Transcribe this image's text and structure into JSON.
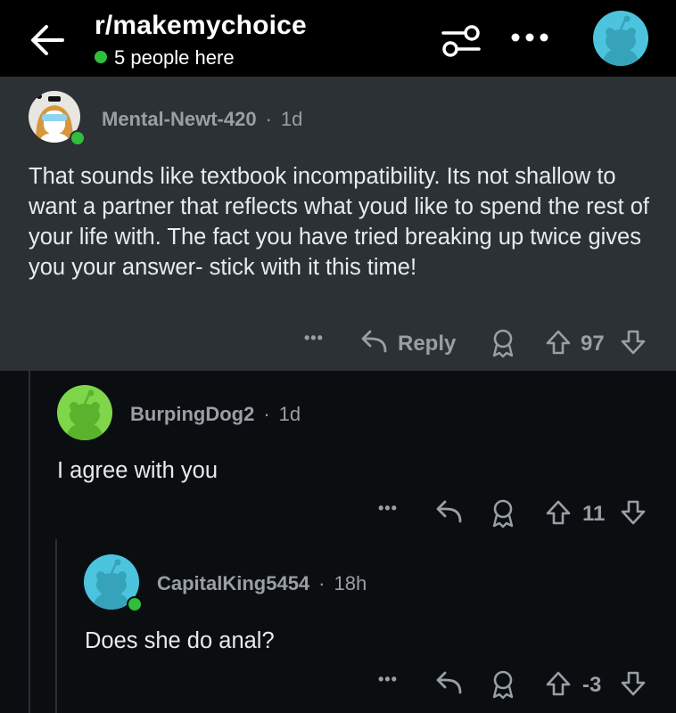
{
  "header": {
    "subreddit": "r/makemychoice",
    "online_count": "5 people here"
  },
  "comments": [
    {
      "username": "Mental-Newt-420",
      "separator": "·",
      "age": "1d",
      "text": "That sounds like textbook incompatibility. Its not shallow to want a partner that reflects what youd like to spend the rest of your life with. The fact you have tried breaking up twice gives you your answer- stick with it this time!",
      "more": "•••",
      "reply_label": "Reply",
      "score": "97",
      "highlighted": true
    },
    {
      "username": "BurpingDog2",
      "separator": "·",
      "age": "1d",
      "text": "I agree with you",
      "more": "•••",
      "score": "11"
    },
    {
      "username": "CapitalKing5454",
      "separator": "·",
      "age": "18h",
      "text": "Does she do anal?",
      "more": "•••",
      "score": "-3"
    }
  ],
  "colors": {
    "online": "#2fbf3b",
    "highlight_bg": "#2c3136",
    "avatar_green": "#7fd64b",
    "avatar_blue": "#4dc4dd"
  }
}
